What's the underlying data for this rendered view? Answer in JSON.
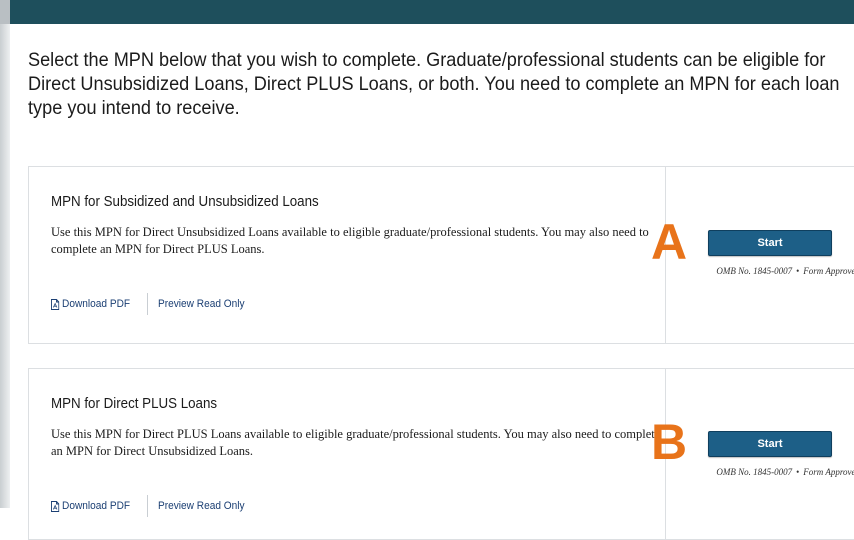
{
  "intro": {
    "text": "Select the MPN below that you wish to complete. Graduate/professional students can be eligible for Direct Unsubsidized Loans, Direct PLUS Loans, or both. You need to complete an MPN for each loan type you intend to receive."
  },
  "cards": [
    {
      "title": "MPN for Subsidized and Unsubsidized Loans",
      "description": "Use this MPN for Direct Unsubsidized Loans available to eligible graduate/professional students. You may also need to complete an MPN for Direct PLUS Loans.",
      "download_label": "Download PDF",
      "preview_label": "Preview Read Only",
      "marker": "A",
      "start_label": "Start",
      "omb_number": "OMB No. 1845-0007",
      "omb_separator": "•",
      "form_status": "Form Approved"
    },
    {
      "title": "MPN for Direct PLUS Loans",
      "description": "Use this MPN for Direct PLUS Loans available to eligible graduate/professional students. You may also need to complete an MPN for Direct Unsubsidized Loans.",
      "download_label": "Download PDF",
      "preview_label": "Preview Read Only",
      "marker": "B",
      "start_label": "Start",
      "omb_number": "OMB No. 1845-0007",
      "omb_separator": "•",
      "form_status": "Form Approved"
    }
  ],
  "colors": {
    "header_bar": "#1e4f5c",
    "start_button": "#1d5f87",
    "link": "#1b3f73",
    "marker": "#e8731a"
  },
  "icons": {
    "download": "pdf-file-icon"
  }
}
